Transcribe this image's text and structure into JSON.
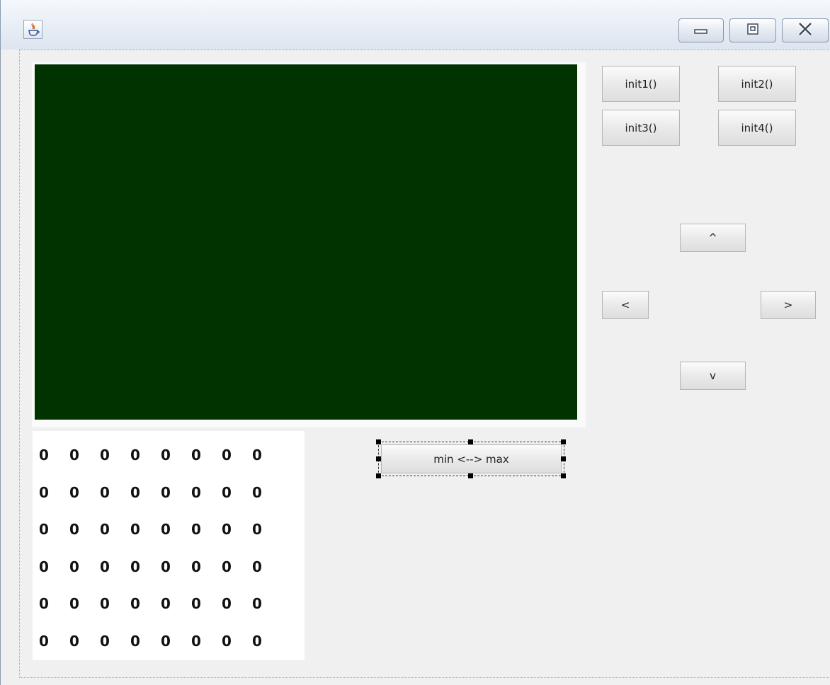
{
  "buttons": {
    "init1": "init1()",
    "init2": "init2()",
    "init3": "init3()",
    "init4": "init4()",
    "up": "^",
    "left": "<",
    "right": ">",
    "down": "v",
    "toggle": "min <--> max"
  },
  "grid": {
    "rows": [
      [
        "0",
        "0",
        "0",
        "0",
        "0",
        "0",
        "0",
        "0"
      ],
      [
        "0",
        "0",
        "0",
        "0",
        "0",
        "0",
        "0",
        "0"
      ],
      [
        "0",
        "0",
        "0",
        "0",
        "0",
        "0",
        "0",
        "0"
      ],
      [
        "0",
        "0",
        "0",
        "0",
        "0",
        "0",
        "0",
        "0"
      ],
      [
        "0",
        "0",
        "0",
        "0",
        "0",
        "0",
        "0",
        "0"
      ],
      [
        "0",
        "0",
        "0",
        "0",
        "0",
        "0",
        "0",
        "0"
      ]
    ]
  },
  "colors": {
    "canvas": "#003300",
    "window_background": "#f0f0f0"
  },
  "icons": {
    "app": "java-icon",
    "minimize": "minimize-icon",
    "maximize": "maximize-icon",
    "close": "close-icon"
  }
}
